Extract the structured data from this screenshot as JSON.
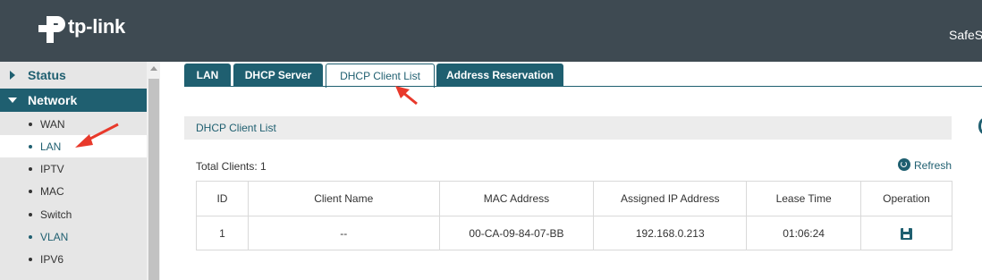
{
  "header": {
    "logo_text": "tp-link",
    "right_text": "SafeS"
  },
  "sidebar": {
    "groups": [
      {
        "label": "Status"
      },
      {
        "label": "Network"
      }
    ],
    "items": [
      {
        "label": "WAN"
      },
      {
        "label": "LAN"
      },
      {
        "label": "IPTV"
      },
      {
        "label": "MAC"
      },
      {
        "label": "Switch"
      },
      {
        "label": "VLAN"
      },
      {
        "label": "IPV6"
      }
    ]
  },
  "tabs": [
    {
      "label": "LAN"
    },
    {
      "label": "DHCP Server"
    },
    {
      "label": "DHCP Client List"
    },
    {
      "label": "Address Reservation"
    }
  ],
  "panel": {
    "title": "DHCP Client List",
    "total_label": "Total Clients: 1",
    "refresh_label": "Refresh"
  },
  "table": {
    "headers": [
      "ID",
      "Client Name",
      "MAC Address",
      "Assigned IP Address",
      "Lease Time",
      "Operation"
    ],
    "rows": [
      {
        "id": "1",
        "client_name": "--",
        "mac": "00-CA-09-84-07-BB",
        "ip": "192.168.0.213",
        "lease": "01:06:24",
        "operation_icon": "save-icon"
      }
    ]
  },
  "colors": {
    "header_bg": "#3e4a52",
    "accent": "#1f5f70",
    "annotation": "#e8392b"
  }
}
